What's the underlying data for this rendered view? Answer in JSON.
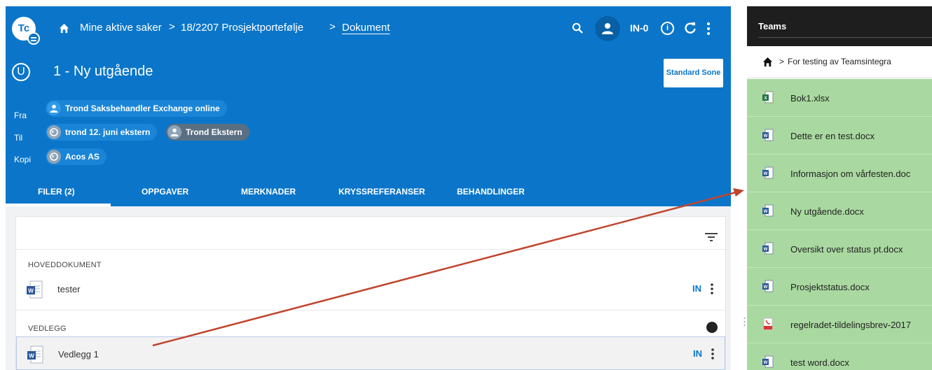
{
  "header": {
    "logo_text": "Tc",
    "breadcrumb": [
      "Mine aktive saker",
      "18/2207 Prosjektportefølje",
      "Dokument"
    ],
    "breadcrumb_sep": ">",
    "in_label": "IN-0",
    "doc_badge": "U",
    "doc_title": "1 - Ny utgående",
    "zone_button": "Standard Sone"
  },
  "meta": {
    "fra_label": "Fra",
    "til_label": "Til",
    "kopi_label": "Kopi",
    "fra": [
      "Trond Saksbehandler Exchange online"
    ],
    "til": [
      "trond 12. juni ekstern",
      "Trond Ekstern"
    ],
    "kopi": [
      "Acos AS"
    ]
  },
  "tabs": [
    "FILER (2)",
    "OPPGAVER",
    "MERKNADER",
    "KRYSSREFERANSER",
    "BEHANDLINGER"
  ],
  "files": {
    "main_section": "HOVEDDOKUMENT",
    "main_file": "tester",
    "attach_section": "VEDLEGG",
    "attach_file": "Vedlegg 1",
    "status": "IN"
  },
  "teams": {
    "title": "Teams",
    "crumb": "For testing av Teamsintegra",
    "items": [
      {
        "name": "Bok1.xlsx",
        "icon": "excel-icon"
      },
      {
        "name": "Dette er en test.docx",
        "icon": "word-icon"
      },
      {
        "name": "Informasjon om vårfesten.doc",
        "icon": "word-icon"
      },
      {
        "name": "Ny utgående.docx",
        "icon": "word-icon"
      },
      {
        "name": "Oversikt over status pt.docx",
        "icon": "word-icon"
      },
      {
        "name": "Prosjektstatus.docx",
        "icon": "word-icon"
      },
      {
        "name": "regelradet-tildelingsbrev-2017",
        "icon": "pdf-icon"
      },
      {
        "name": "test word.docx",
        "icon": "word-icon"
      }
    ]
  },
  "colors": {
    "header_blue": "#0b76c9",
    "teams_green": "#a9d9a0",
    "arrow_red": "#c0452e"
  }
}
